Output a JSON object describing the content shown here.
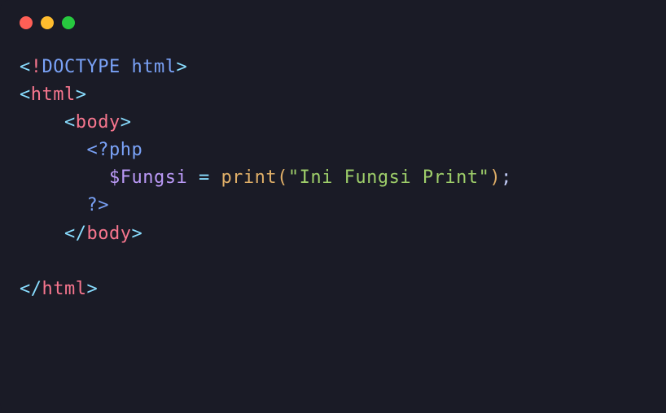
{
  "traffic_lights": {
    "red": "#ff5f56",
    "yellow": "#ffbd2e",
    "green": "#27c93f"
  },
  "code": {
    "line1": {
      "open_bracket": "<",
      "excl": "!",
      "doctype": "DOCTYPE html",
      "close_bracket": ">"
    },
    "line2": {
      "open_bracket": "<",
      "tag": "html",
      "close_bracket": ">"
    },
    "line3": {
      "indent": "    ",
      "open_bracket": "<",
      "tag": "body",
      "close_bracket": ">"
    },
    "line4": {
      "indent": "      ",
      "php_open": "<?php"
    },
    "line5": {
      "indent": "        ",
      "variable": "$Fungsi",
      "space1": " ",
      "equals": "=",
      "space2": " ",
      "function": "print",
      "lparen": "(",
      "string": "\"Ini Fungsi Print\"",
      "rparen": ")",
      "semi": ";"
    },
    "line6": {
      "indent": "      ",
      "php_close": "?>"
    },
    "line7": {
      "indent": "    ",
      "open_bracket": "</",
      "tag": "body",
      "close_bracket": ">"
    },
    "line8": {
      "blank": ""
    },
    "line9": {
      "open_bracket": "</",
      "tag": "html",
      "close_bracket": ">"
    }
  }
}
